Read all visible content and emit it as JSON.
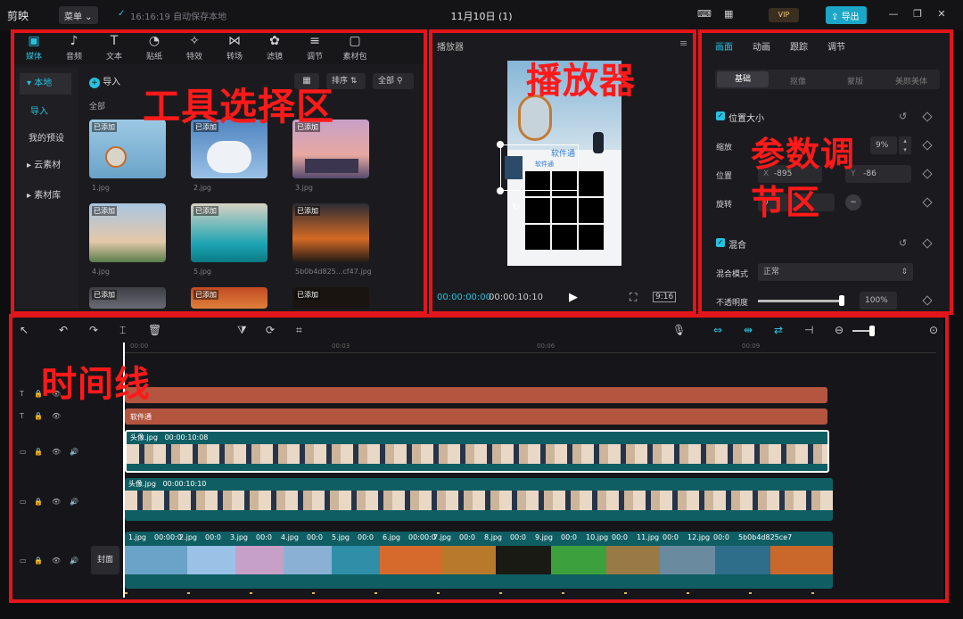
{
  "topbar": {
    "app_name": "剪映",
    "menu_label": "菜单",
    "status": "16:16:19 自动保存本地",
    "title": "11月10日 (1)",
    "vip": "VIP",
    "export": "导出"
  },
  "toolbar": {
    "items": [
      "媒体",
      "音频",
      "文本",
      "贴纸",
      "特效",
      "转场",
      "滤镜",
      "调节",
      "素材包"
    ],
    "icons": [
      "▣",
      "♪",
      "T",
      "◔",
      "✧",
      "⋈",
      "✿",
      "≡",
      "▢"
    ]
  },
  "media": {
    "import_label": "导入",
    "sort_label": "排序",
    "filter_label": "全部",
    "section_all": "全部",
    "sidebar": [
      "本地",
      "导入",
      "我的预设",
      "云素材",
      "素材库"
    ],
    "added_tag": "已添加",
    "files": [
      "1.jpg",
      "2.jpg",
      "3.jpg",
      "4.jpg",
      "5.jpg",
      "5b0b4d825...cf47.jpg"
    ],
    "colors": [
      "#7fb8d8",
      "#5a8fc4",
      "#c98fb0",
      "#8ab0d4",
      "#2f8fa8",
      "#d66a2c",
      "#3d3d44",
      "#b23a1c",
      "#1a1410"
    ]
  },
  "player": {
    "title": "播放器",
    "overlay_app": "软件通",
    "overlay_sub": "软件通",
    "time_current": "00:00:00:00",
    "time_total": "00:00:10:10",
    "ratio": "9:16"
  },
  "params": {
    "tabs": [
      "画面",
      "动画",
      "跟踪",
      "调节"
    ],
    "subtabs": [
      "基础",
      "抠像",
      "蒙版",
      "美颜美体"
    ],
    "section_pos": "位置大小",
    "scale_label": "缩放",
    "scale_value": "9%",
    "pos_label": "位置",
    "x_label": "X",
    "x_value": "-895",
    "y_label": "Y",
    "y_value": "-86",
    "rotate_label": "旋转",
    "rotate_value": "0",
    "section_mix": "混合",
    "mode_label": "混合模式",
    "mode_value": "正常",
    "opacity_label": "不透明度",
    "opacity_value": "100%",
    "opacity_level": 0.98
  },
  "timeline": {
    "ruler": [
      "00:00",
      "00:03",
      "00:06",
      "00:09"
    ],
    "text_track_2": "软件通",
    "video1_label": "头像.jpg",
    "video1_time": "00:00:10:08",
    "video2_label": "头像.jpg",
    "video2_time": "00:00:10:10",
    "cover_label": "封面",
    "main_clips": [
      "1.jpg",
      "00:00:0",
      "2.jpg",
      "00:0",
      "3.jpg",
      "00:0",
      "4.jpg",
      "00:0",
      "5.jpg",
      "00:0",
      "6.jpg",
      "00:00:0",
      "7.jpg",
      "00:0",
      "8.jpg",
      "00:0",
      "9.jpg",
      "00:0",
      "10.jpg",
      "00:0",
      "11.jpg",
      "00:0",
      "12.jpg",
      "00:0",
      "5b0b4d825ce7"
    ]
  },
  "annotations": {
    "tools": "工具选择区",
    "player": "播放器",
    "params_1": "参数调",
    "params_2": "节区",
    "timeline": "时间线"
  },
  "colors": {
    "accent": "#26c2e0",
    "annotation_red": "#e3151b",
    "text_track": "#b4553f",
    "video_track": "#0e5e63"
  }
}
